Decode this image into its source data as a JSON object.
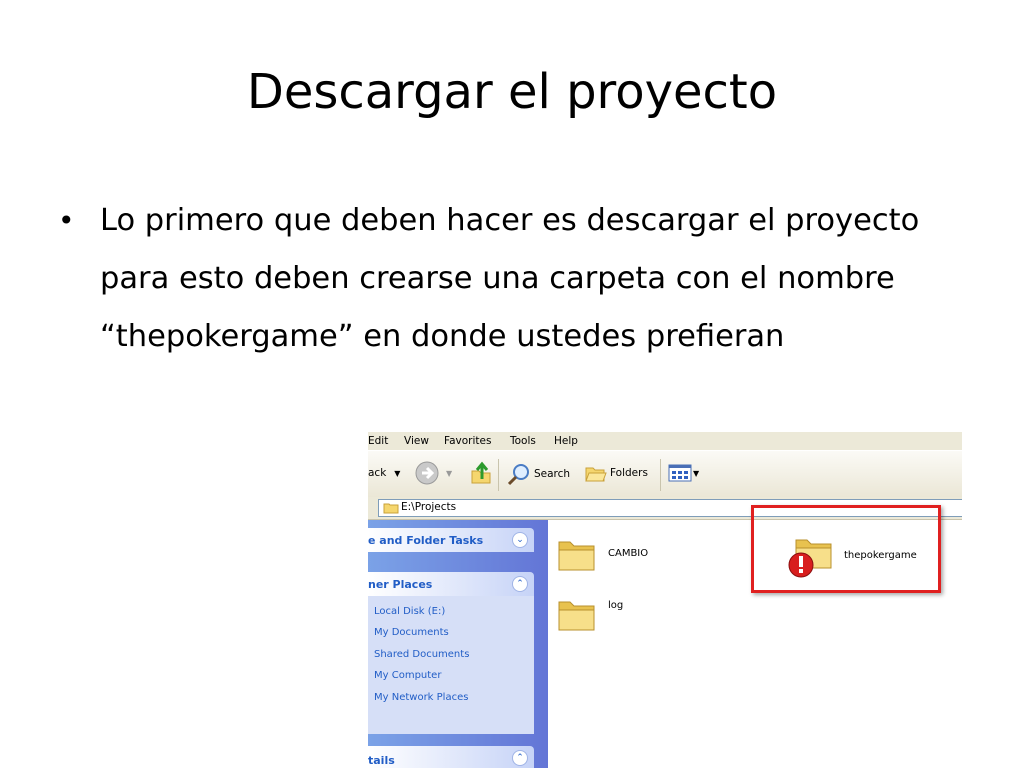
{
  "slide": {
    "title": "Descargar el proyecto",
    "bullet": "Lo primero que deben hacer es descargar el proyecto para esto deben crearse una carpeta con el nombre “thepokergame” en donde ustedes prefieran"
  },
  "explorer": {
    "menu": [
      "Edit",
      "View",
      "Favorites",
      "Tools",
      "Help"
    ],
    "toolbar": {
      "back_label": "ack",
      "search_label": "Search",
      "folders_label": "Folders"
    },
    "address": "E:\\Projects",
    "tasks": {
      "file_folder_tasks": "e and Folder Tasks",
      "other_places": "ner Places",
      "details": "tails",
      "places": [
        "Local Disk (E:)",
        "My Documents",
        "Shared Documents",
        "My Computer",
        "My Network Places"
      ]
    },
    "files": [
      {
        "name": "CAMBIO"
      },
      {
        "name": "log"
      },
      {
        "name": "thepokergame",
        "warning": true
      }
    ],
    "colors": {
      "task_link": "#215dc6",
      "highlight": "#e02020",
      "folder": "#f5d66e"
    }
  }
}
